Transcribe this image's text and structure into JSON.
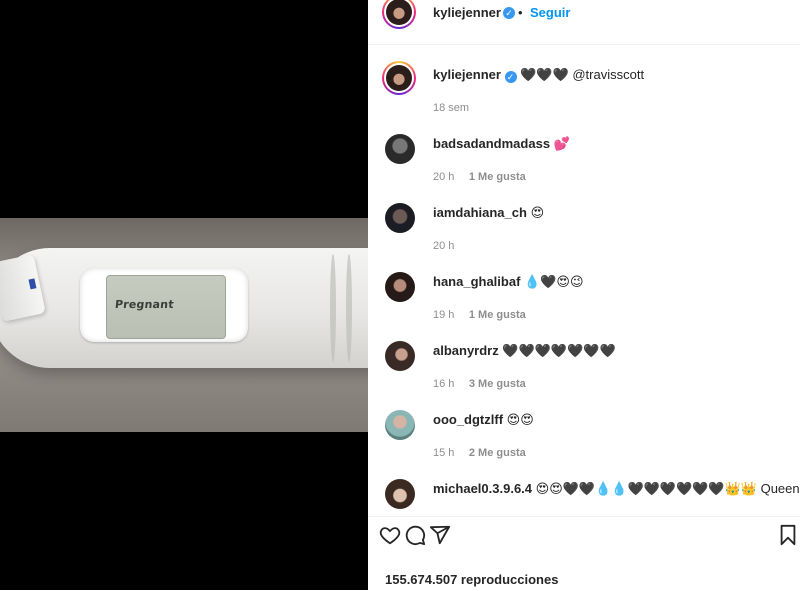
{
  "media": {
    "lcd_text": "Pregnant"
  },
  "header": {
    "username": "kyliejenner",
    "dot": "•",
    "follow_label": "Seguir",
    "verified_glyph": "✓"
  },
  "caption": {
    "username": "kyliejenner",
    "text": "🖤🖤🖤 @travisscott",
    "time": "18 sem"
  },
  "comments": [
    {
      "username": "badsadandmadass",
      "text": "💕",
      "time": "20 h",
      "likes": "1 Me gusta"
    },
    {
      "username": "iamdahiana_ch",
      "text": "😍",
      "time": "20 h",
      "likes": ""
    },
    {
      "username": "hana_ghalibaf",
      "text": "💧🖤😍😉",
      "time": "19 h",
      "likes": "1 Me gusta"
    },
    {
      "username": "albanyrdrz",
      "text": "🖤🖤🖤🖤🖤🖤🖤",
      "time": "16 h",
      "likes": "3 Me gusta"
    },
    {
      "username": "ooo_dgtzlff",
      "text": "😍😍",
      "time": "15 h",
      "likes": "2 Me gusta"
    },
    {
      "username": "michael0.3.9.6.4",
      "text": "😍😍🖤🖤💧💧🖤🖤🖤🖤🖤🖤👑👑 Queen 👑🖤",
      "time": "",
      "likes": ""
    }
  ],
  "actions": {
    "views": "155.674.507 reproducciones"
  },
  "colors": {
    "accent": "#0095f6",
    "verified": "#3897f0",
    "muted": "#8e8e8e",
    "text": "#262626"
  },
  "icons": [
    "heart-icon",
    "comment-icon",
    "share-icon",
    "bookmark-icon",
    "verified-badge-icon"
  ]
}
